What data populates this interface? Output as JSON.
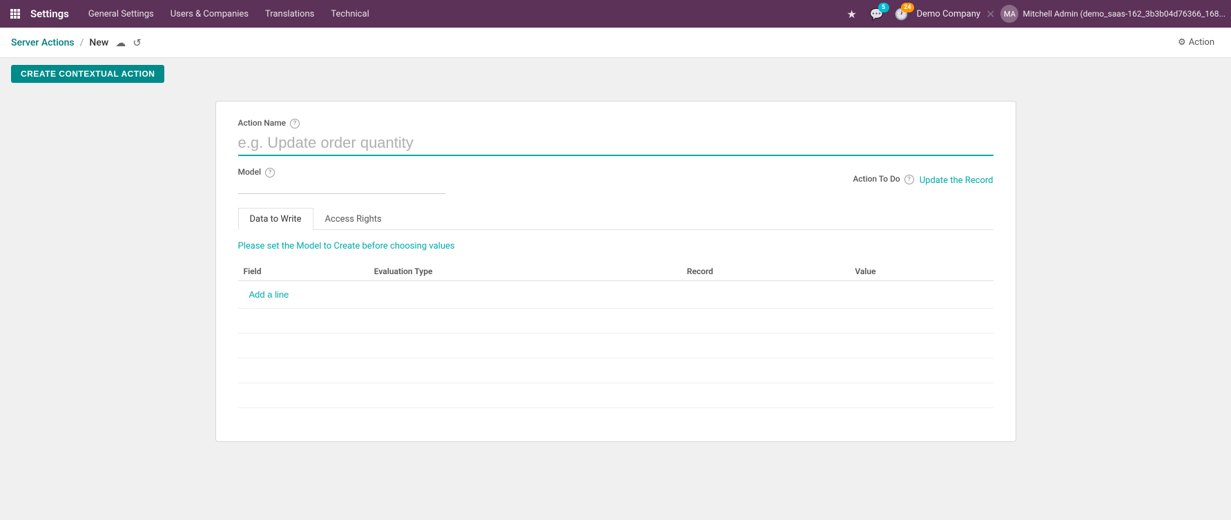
{
  "app": {
    "name": "Settings"
  },
  "topnav": {
    "menu_items": [
      "General Settings",
      "Users & Companies",
      "Translations",
      "Technical"
    ],
    "company": "Demo Company",
    "user": "Mitchell Admin (demo_saas-162_3b3b04d76366_168...",
    "user_short": "MA",
    "chat_badge": "5",
    "clock_badge": "24"
  },
  "breadcrumb": {
    "parent": "Server Actions",
    "separator": "/",
    "current": "New",
    "save_icon": "☁",
    "discard_icon": "↺"
  },
  "toolbar": {
    "create_contextual_label": "CREATE CONTEXTUAL ACTION"
  },
  "action_menu": {
    "label": "Action"
  },
  "form": {
    "action_name_label": "Action Name",
    "action_name_placeholder": "e.g. Update order quantity",
    "model_label": "Model",
    "action_to_do_label": "Action To Do",
    "action_to_do_value": "Update the Record"
  },
  "tabs": [
    {
      "id": "data-to-write",
      "label": "Data to Write",
      "active": true
    },
    {
      "id": "access-rights",
      "label": "Access Rights",
      "active": false
    }
  ],
  "table": {
    "info_message": "Please set the Model to Create before choosing values",
    "columns": [
      "Field",
      "Evaluation Type",
      "Record",
      "Value"
    ],
    "add_line_label": "Add a line"
  }
}
